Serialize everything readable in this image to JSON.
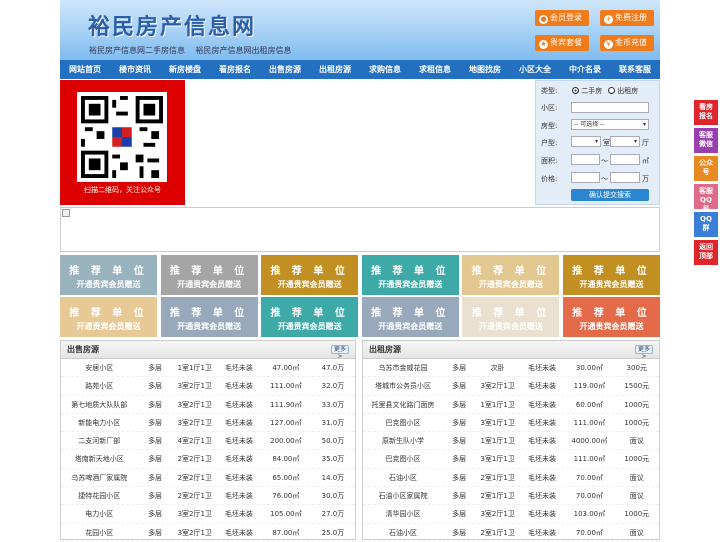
{
  "site": {
    "title": "裕民房产信息网",
    "sublinks": [
      "裕民房产信息网二手房信息",
      "裕民房产信息网出租房信息"
    ]
  },
  "header_buttons": [
    {
      "label": "会员登录",
      "icon": "user-icon"
    },
    {
      "label": "免费注册",
      "icon": "user-add-icon"
    },
    {
      "label": "贵宾套餐",
      "icon": "vip-icon"
    },
    {
      "label": "金币充值",
      "icon": "coin-icon"
    }
  ],
  "nav": [
    "网站首页",
    "楼市资讯",
    "新房楼盘",
    "看房报名",
    "出售房源",
    "出租房源",
    "求购信息",
    "求租信息",
    "地图找房",
    "小区大全",
    "中介名录",
    "联系客服"
  ],
  "qr": {
    "caption": "扫描二维码，关注公众号"
  },
  "search": {
    "type_label": "类型:",
    "opt1": "二手房",
    "opt2": "出租房",
    "community_label": "小区:",
    "house_type_label": "房型:",
    "house_type_value": "-- 可选择 --",
    "layout_label": "户型:",
    "room": "室",
    "hall": "厅",
    "area_label": "面积:",
    "area_unit": "㎡",
    "price_label": "价格:",
    "price_unit": "万",
    "tilde": "〜",
    "submit": "确认提交搜索"
  },
  "tiles": {
    "line1": "推 荐 单 位",
    "line2": "开通贵宾会员赠送",
    "colors": [
      "#98b3bd",
      "#a5a5a5",
      "#c28f22",
      "#3eaaa8",
      "#e3c791",
      "#c28f22",
      "#e7c995",
      "#98a9bb",
      "#3eaaa8",
      "#98a9bb",
      "#e9e0d0",
      "#e56a4a"
    ]
  },
  "sale": {
    "title": "出售房源",
    "more": "更多>",
    "rows": [
      [
        "安居小区",
        "多层",
        "1室1厅1卫",
        "毛坯未装",
        "47.00㎡",
        "47.0万"
      ],
      [
        "路苑小区",
        "多层",
        "3室2厅1卫",
        "毛坯未装",
        "111.00㎡",
        "32.0万"
      ],
      [
        "第七地质大队队部",
        "多层",
        "3室2厅1卫",
        "毛坯未装",
        "111.90㎡",
        "33.0万"
      ],
      [
        "新能电力小区",
        "多层",
        "3室2厅1卫",
        "毛坯未装",
        "127.00㎡",
        "31.0万"
      ],
      [
        "二支河新厂部",
        "多层",
        "4室2厅1卫",
        "毛坯未装",
        "200.00㎡",
        "50.0万"
      ],
      [
        "塔南新天地小区",
        "多层",
        "2室2厅1卫",
        "毛坯未装",
        "84.00㎡",
        "35.0万"
      ],
      [
        "乌苏啤酒厂家属院",
        "多层",
        "2室2厅1卫",
        "毛坯未装",
        "65.00㎡",
        "14.0万"
      ],
      [
        "捷特花园小区",
        "多层",
        "2室2厅1卫",
        "毛坯未装",
        "76.00㎡",
        "30.0万"
      ],
      [
        "电力小区",
        "多层",
        "3室2厅1卫",
        "毛坯未装",
        "105.00㎡",
        "27.0万"
      ],
      [
        "花园小区",
        "多层",
        "3室2厅1卫",
        "毛坯未装",
        "87.00㎡",
        "25.0万"
      ]
    ]
  },
  "rent": {
    "title": "出租房源",
    "more": "更多>",
    "rows": [
      [
        "乌苏市金威花园",
        "多层",
        "次卧",
        "毛坯未装",
        "30.00㎡",
        "300元"
      ],
      [
        "塔城市公务员小区",
        "多层",
        "3室2厅1卫",
        "毛坯未装",
        "119.00㎡",
        "1500元"
      ],
      [
        "托里县文化路门面房",
        "多层",
        "1室1厅1卫",
        "毛坯未装",
        "60.00㎡",
        "1000元"
      ],
      [
        "巴克图小区",
        "多层",
        "3室1厅1卫",
        "毛坯未装",
        "111.00㎡",
        "1000元"
      ],
      [
        "原新生队小学",
        "多层",
        "1室1厅1卫",
        "毛坯未装",
        "4000.00㎡",
        "面议"
      ],
      [
        "巴克图小区",
        "多层",
        "3室1厅1卫",
        "毛坯未装",
        "111.00㎡",
        "1000元"
      ],
      [
        "石油小区",
        "多层",
        "2室1厅1卫",
        "毛坯未装",
        "70.00㎡",
        "面议"
      ],
      [
        "石油小区家属院",
        "多层",
        "2室1厅1卫",
        "毛坯未装",
        "70.00㎡",
        "面议"
      ],
      [
        "清华园小区",
        "多层",
        "3室2厅1卫",
        "毛坯未装",
        "103.00㎡",
        "1000元"
      ],
      [
        "石油小区",
        "多层",
        "2室1厅1卫",
        "毛坯未装",
        "70.00㎡",
        "面议"
      ]
    ]
  },
  "sidebar": [
    {
      "label": "看房报名",
      "color": "#e0242b"
    },
    {
      "label": "客服微信",
      "color": "#9a3fb0"
    },
    {
      "label": "公众号",
      "color": "#e88a22"
    },
    {
      "label": "客服QQ号",
      "color": "#e06a8a"
    },
    {
      "label": "QQ群",
      "color": "#3a7ed8"
    },
    {
      "label": "返回顶部",
      "color": "#e0242b"
    }
  ]
}
